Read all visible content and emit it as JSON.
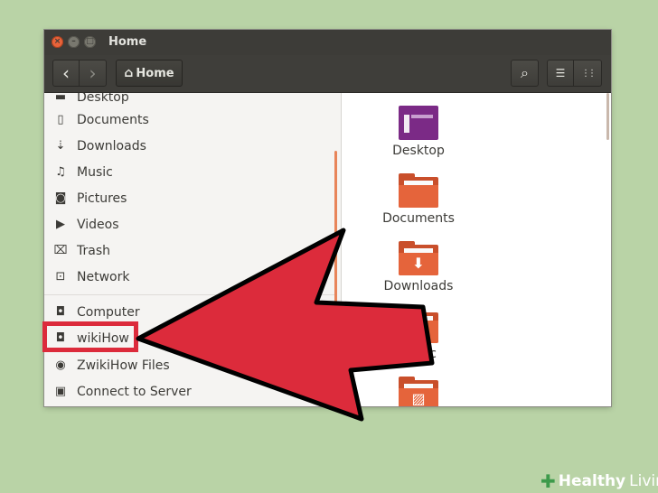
{
  "window": {
    "title": "Home"
  },
  "toolbar": {
    "back_icon": "‹",
    "forward_icon": "›",
    "home_icon": "⌂",
    "location": "Home",
    "search_icon": "⌕",
    "list_view_icon": "☰",
    "grid_view_icon": "⋮⋮"
  },
  "sidebar": {
    "items": [
      {
        "label": "Desktop",
        "icon": "desktop-icon",
        "glyph": "▬"
      },
      {
        "label": "Documents",
        "icon": "documents-icon",
        "glyph": "▯"
      },
      {
        "label": "Downloads",
        "icon": "downloads-icon",
        "glyph": "⇣"
      },
      {
        "label": "Music",
        "icon": "music-icon",
        "glyph": "♫"
      },
      {
        "label": "Pictures",
        "icon": "pictures-icon",
        "glyph": "◙"
      },
      {
        "label": "Videos",
        "icon": "videos-icon",
        "glyph": "▶"
      },
      {
        "label": "Trash",
        "icon": "trash-icon",
        "glyph": "⌧"
      },
      {
        "label": "Network",
        "icon": "network-icon",
        "glyph": "⊡"
      },
      {
        "label": "Computer",
        "icon": "computer-icon",
        "glyph": "◘"
      },
      {
        "label": "wikiHow",
        "icon": "drive-icon",
        "glyph": "◘"
      },
      {
        "label": "ZwikiHow Files",
        "icon": "disc-icon",
        "glyph": "◉"
      },
      {
        "label": "Connect to Server",
        "icon": "server-icon",
        "glyph": "▣"
      }
    ]
  },
  "content": {
    "folders": [
      {
        "label": "Desktop",
        "icon": "desktop-folder-icon",
        "color": "#7b2a86",
        "glyph": ""
      },
      {
        "label": "Documents",
        "icon": "documents-folder-icon",
        "color": "#e5643b",
        "glyph": ""
      },
      {
        "label": "Downloads",
        "icon": "downloads-folder-icon",
        "color": "#e5643b",
        "glyph": "⬇"
      },
      {
        "label": "Music",
        "icon": "music-folder-icon",
        "color": "#e5643b",
        "glyph": "♫"
      },
      {
        "label": "",
        "icon": "pictures-folder-icon",
        "color": "#e5643b",
        "glyph": "▨"
      }
    ]
  },
  "colors": {
    "highlight": "#dc2b3b",
    "arrow": "#dc2b3b",
    "accent": "#e5643b"
  },
  "watermark": {
    "part1": "Healthy",
    "part2": "Living"
  }
}
